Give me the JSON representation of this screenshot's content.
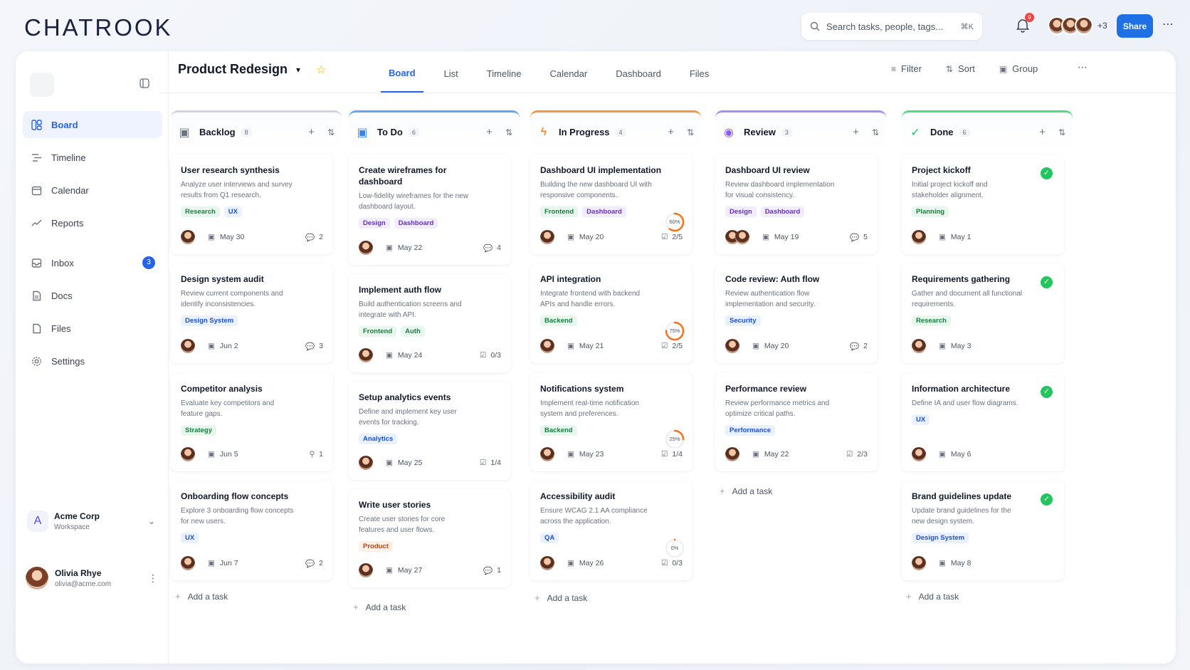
{
  "app": {
    "logo": "CHATROOK"
  },
  "topbar": {
    "search_placeholder": "Search tasks, people, tags...",
    "search_shortcut": "⌘K",
    "notif_count": "9",
    "avatar_more": "+3",
    "share_label": "Share"
  },
  "sidebar": {
    "items": [
      {
        "label": "Board",
        "icon": "board-icon"
      },
      {
        "label": "Timeline",
        "icon": "timeline-icon"
      },
      {
        "label": "Calendar",
        "icon": "calendar-icon"
      },
      {
        "label": "Reports",
        "icon": "reports-icon"
      },
      {
        "label": "Inbox",
        "icon": "inbox-icon",
        "badge": "3"
      },
      {
        "label": "Docs",
        "icon": "docs-icon"
      },
      {
        "label": "Files",
        "icon": "files-icon"
      },
      {
        "label": "Settings",
        "icon": "settings-icon"
      }
    ],
    "workspace": {
      "initial": "A",
      "name": "Acme Corp",
      "sub": "Workspace"
    },
    "user": {
      "name": "Olivia Rhye",
      "email": "olivia@acme.com"
    }
  },
  "project": {
    "title": "Product Redesign",
    "tabs": [
      "Board",
      "List",
      "Timeline",
      "Calendar",
      "Dashboard",
      "Files"
    ],
    "tools": [
      "Filter",
      "Sort",
      "Group"
    ]
  },
  "colors": {
    "accent": "#2563eb",
    "backlog": "#cbd5e1",
    "todo": "#60a5fa",
    "inprogress": "#fb923c",
    "review": "#a78bfa",
    "done": "#4ade80"
  },
  "columns": [
    {
      "title": "Backlog",
      "count": "8",
      "add_label": "Add a task",
      "cards": [
        {
          "title": "User research synthesis",
          "desc": "Analyze user interviews and survey results from Q1 research.",
          "tags": [
            "Research",
            "UX"
          ],
          "date": "May 30",
          "stat": "2"
        },
        {
          "title": "Design system audit",
          "desc": "Review current components and identify inconsistencies.",
          "tags": [
            "Design System"
          ],
          "date": "Jun 2",
          "stat": "3"
        },
        {
          "title": "Competitor analysis",
          "desc": "Evaluate key competitors and feature gaps.",
          "tags": [
            "Strategy"
          ],
          "date": "Jun 5",
          "stat": "1"
        },
        {
          "title": "Onboarding flow concepts",
          "desc": "Explore 3 onboarding flow concepts for new users.",
          "tags": [
            "UX"
          ],
          "date": "Jun 7",
          "stat": "2"
        }
      ]
    },
    {
      "title": "To Do",
      "count": "6",
      "add_label": "Add a task",
      "cards": [
        {
          "title": "Create wireframes for dashboard",
          "desc": "Low-fidelity wireframes for the new dashboard layout.",
          "tags": [
            "Design",
            "Dashboard"
          ],
          "date": "May 22",
          "stat": "4"
        },
        {
          "title": "Implement auth flow",
          "desc": "Build authentication screens and integrate with API.",
          "tags": [
            "Frontend",
            "Auth"
          ],
          "date": "May 24",
          "stat": "0/3"
        },
        {
          "title": "Setup analytics events",
          "desc": "Define and implement key user events for tracking.",
          "tags": [
            "Analytics"
          ],
          "date": "May 25",
          "stat": "1/4"
        },
        {
          "title": "Write user stories",
          "desc": "Create user stories for core features and user flows.",
          "tags": [
            "Product"
          ],
          "date": "May 27",
          "stat": "1"
        }
      ]
    },
    {
      "title": "In Progress",
      "count": "4",
      "add_label": "Add a task",
      "cards": [
        {
          "title": "Dashboard UI implementation",
          "desc": "Building the new dashboard UI with responsive components.",
          "tags": [
            "Frontend",
            "Dashboard"
          ],
          "date": "May 20",
          "stat": "2/5",
          "progress": "60%",
          "progress_value": 0.6
        },
        {
          "title": "API integration",
          "desc": "Integrate frontend with backend APIs and handle errors.",
          "tags": [
            "Backend"
          ],
          "date": "May 21",
          "stat": "2/5",
          "progress": "75%",
          "progress_value": 0.75
        },
        {
          "title": "Notifications system",
          "desc": "Implement real-time notification system and preferences.",
          "tags": [
            "Backend"
          ],
          "date": "May 23",
          "stat": "1/4",
          "progress": "25%",
          "progress_value": 0.25
        },
        {
          "title": "Accessibility audit",
          "desc": "Ensure WCAG 2.1 AA compliance across the application.",
          "tags": [
            "QA"
          ],
          "date": "May 26",
          "stat": "0/3",
          "progress": "0%",
          "progress_value": 0
        }
      ]
    },
    {
      "title": "Review",
      "count": "3",
      "add_label": "Add a task",
      "cards": [
        {
          "title": "Dashboard UI review",
          "desc": "Review dashboard implementation for visual consistency.",
          "tags": [
            "Design",
            "Dashboard"
          ],
          "date": "May 19",
          "stat": "5"
        },
        {
          "title": "Code review: Auth flow",
          "desc": "Review authentication flow implementation and security.",
          "tags": [
            "Security"
          ],
          "date": "May 20",
          "stat": "2"
        },
        {
          "title": "Performance review",
          "desc": "Review performance metrics and optimize critical paths.",
          "tags": [
            "Performance"
          ],
          "date": "May 22",
          "stat": "2/3"
        }
      ]
    },
    {
      "title": "Done",
      "count": "6",
      "add_label": "Add a task",
      "cards": [
        {
          "title": "Project kickoff",
          "desc": "Initial project kickoff and stakeholder alignment.",
          "tags": [
            "Planning"
          ],
          "date": "May 1"
        },
        {
          "title": "Requirements gathering",
          "desc": "Gather and document all functional requirements.",
          "tags": [
            "Research"
          ],
          "date": "May 3"
        },
        {
          "title": "Information architecture",
          "desc": "Define IA and user flow diagrams.",
          "tags": [
            "UX"
          ],
          "date": "May 6"
        },
        {
          "title": "Brand guidelines update",
          "desc": "Update brand guidelines for the new design system.",
          "tags": [
            "Design System"
          ],
          "date": "May 8"
        }
      ]
    }
  ]
}
